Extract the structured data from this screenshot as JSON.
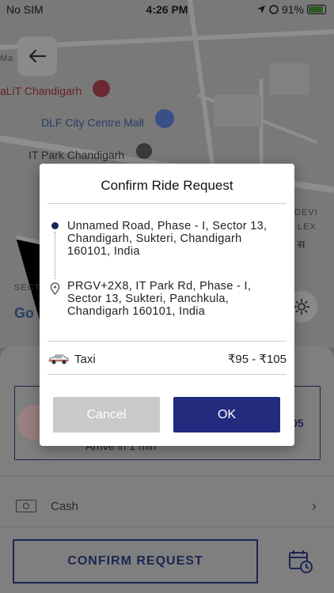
{
  "status_bar": {
    "carrier": "No SIM",
    "time": "4:26 PM",
    "battery": "91%"
  },
  "map": {
    "labels": {
      "label_1": "Ma",
      "label_2": "aLiT Chandigarh",
      "label_3": "DLF City Centre Mall",
      "label_4": "IT Park Chandigarh",
      "label_5": "DEVI",
      "label_6": "LEX",
      "label_7": "स",
      "label_8": "SECT",
      "label_9": "Go"
    }
  },
  "dialog": {
    "title": "Confirm Ride Request",
    "pickup": "Unnamed Road, Phase - I, Sector 13, Chandigarh, Sukteri, Chandigarh 160101, India",
    "drop": "PRGV+2X8, IT Park Rd, Phase - I, Sector 13, Sukteri, Panchkula, Chandigarh 160101, India",
    "vehicle": "Taxi",
    "price_range": "₹95 - ₹105",
    "cancel_label": "Cancel",
    "ok_label": "OK"
  },
  "sheet": {
    "vehicle_eta": "Arrive in 1 min",
    "vehicle_price_partial": "05",
    "payment_method": "Cash",
    "confirm_label": "CONFIRM REQUEST"
  },
  "icons": {
    "back": "back-arrow-icon",
    "gear": "settings-icon",
    "schedule": "calendar-clock-icon",
    "cash": "cash-icon",
    "chevron": "chevron-right-icon",
    "taxi": "taxi-car-icon"
  },
  "colors": {
    "primary": "#232b7e",
    "pickup_dot": "#1d2552",
    "cancel_bg": "#c9c9c9",
    "scrim": "#6b6b6b"
  }
}
